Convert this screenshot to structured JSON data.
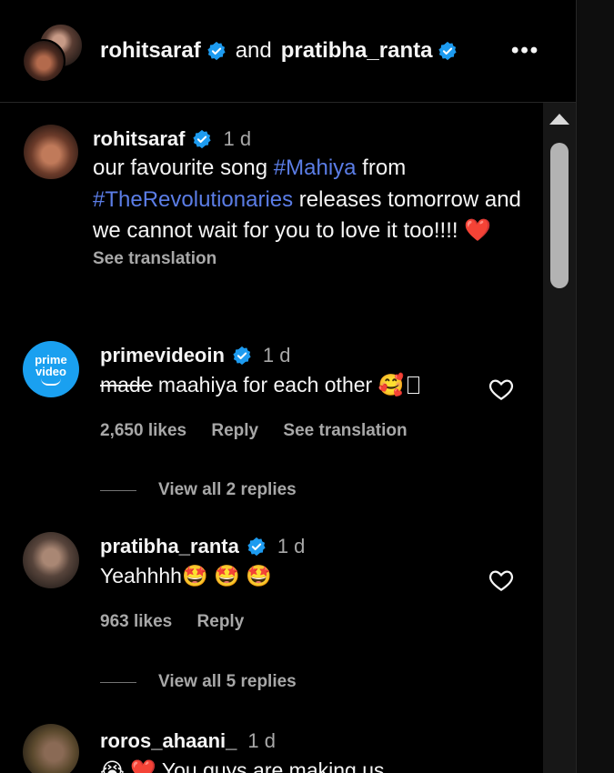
{
  "header": {
    "user1": "rohitsaraf",
    "conjunction": "and",
    "user2": "pratibha_ranta",
    "more_label": "•••"
  },
  "post": {
    "username": "rohitsaraf",
    "time": "1 d",
    "text_before": "our favourite song ",
    "hashtag1": "#Mahiya",
    "text_mid": " from ",
    "hashtag2": "#TheRevolutionaries",
    "text_after": " releases tomorrow and we cannot wait for you to love it too!!!! ",
    "heart": "❤️",
    "see_translation": "See translation"
  },
  "comments": [
    {
      "username": "primevideoin",
      "time": "1 d",
      "strike_text": "made",
      "text": " maahiya for each other 🥰",
      "likes": "2,650 likes",
      "reply": "Reply",
      "see_translation": "See translation",
      "view_replies": "View all 2 replies",
      "avatar_text1": "prime",
      "avatar_text2": "video"
    },
    {
      "username": "pratibha_ranta",
      "time": "1 d",
      "text": "Yeahhhh🤩 🤩 🤩",
      "likes": "963 likes",
      "reply": "Reply",
      "view_replies": "View all 5 replies"
    },
    {
      "username": "roros_ahaani_",
      "time": "1 d",
      "text": "😭 ❤️  You guys are making us"
    }
  ]
}
